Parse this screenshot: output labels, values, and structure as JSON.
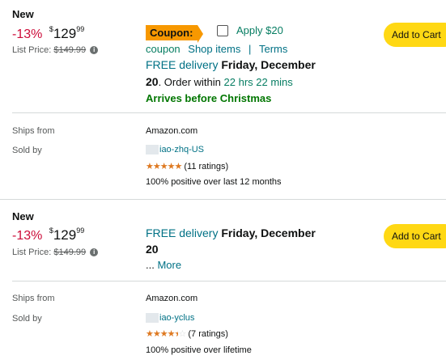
{
  "offers": [
    {
      "condition": "New",
      "discount": "-13%",
      "price_symbol": "$",
      "price_whole": "129",
      "price_fraction": "99",
      "list_price_label": "List Price:",
      "list_price": "$149.99",
      "coupon": {
        "badge": "Coupon:",
        "apply_label": "Apply $20",
        "coupon_word": "coupon",
        "shop_items": "Shop items",
        "separator": "|",
        "terms": "Terms"
      },
      "delivery": {
        "free": "FREE delivery",
        "date_line1": "Friday, December",
        "date_day": "20",
        "order_within_text": ". Order within",
        "time_left": "22 hrs 22 mins",
        "arrives_note": "Arrives before Christmas"
      },
      "add_to_cart": "Add to Cart",
      "ships_from_label": "Ships from",
      "ships_from_value": "Amazon.com",
      "sold_by_label": "Sold by",
      "seller_name": "iao-zhq-US",
      "seller_stars": 5,
      "seller_ratings": "(11 ratings)",
      "seller_positive": "100% positive over last 12 months"
    },
    {
      "condition": "New",
      "discount": "-13%",
      "price_symbol": "$",
      "price_whole": "129",
      "price_fraction": "99",
      "list_price_label": "List Price:",
      "list_price": "$149.99",
      "delivery": {
        "free": "FREE delivery",
        "date_line1": "Friday, December",
        "date_day": "20",
        "more_prefix": "...",
        "more_link": "More"
      },
      "add_to_cart": "Add to Cart",
      "ships_from_label": "Ships from",
      "ships_from_value": "Amazon.com",
      "sold_by_label": "Sold by",
      "seller_name": "iao-yclus",
      "seller_stars": 4.5,
      "seller_ratings": "(7 ratings)",
      "seller_positive": "100% positive over lifetime"
    }
  ],
  "icons": {
    "star_full": "★",
    "star_half": "half-star",
    "info": "i"
  },
  "colors": {
    "discount": "#cc0c39",
    "link": "#007185",
    "arrives": "#007600",
    "coupon_badge": "#f79800",
    "cart_button": "#ffd814",
    "stars": "#de7921"
  }
}
